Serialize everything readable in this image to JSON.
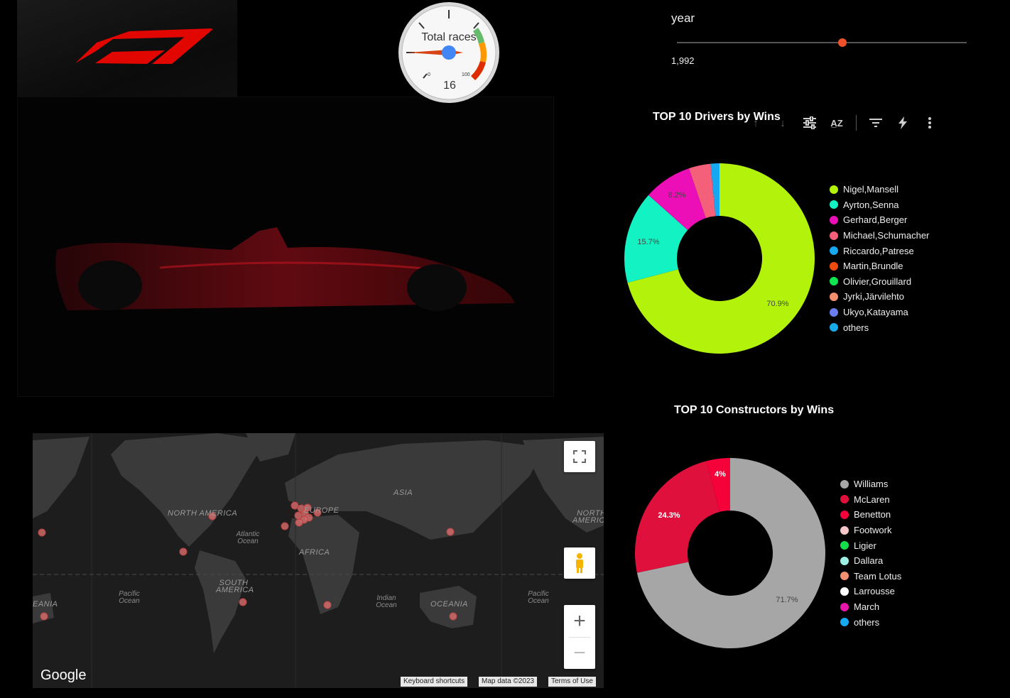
{
  "gauge": {
    "label": "Total races",
    "value": 16,
    "min_label": "0",
    "max_label": "100"
  },
  "slider": {
    "label": "year",
    "value": "1,992",
    "fraction": 0.57
  },
  "toolbar": {
    "icons": [
      "arrow-up-icon",
      "arrow-down-icon",
      "tune-icon",
      "sort-az-icon",
      "filter-icon",
      "bolt-icon",
      "more-vert-icon"
    ]
  },
  "drivers_chart": {
    "title": "TOP 10 Drivers by Wins",
    "legend": [
      "Nigel,Mansell",
      "Ayrton,Senna",
      "Gerhard,Berger",
      "Michael,Schumacher",
      "Riccardo,Patrese",
      "Martin,Brundle",
      "Olivier,Grouillard",
      "Jyrki,Järvilehto",
      "Ukyo,Katayama",
      "others"
    ],
    "colors": [
      "#b3f20b",
      "#13f2c3",
      "#ec0fb7",
      "#f4607a",
      "#16a8f0",
      "#ef4a10",
      "#0fe550",
      "#f49070",
      "#6d7cf0",
      "#17a9e9"
    ]
  },
  "constructors_chart": {
    "title": "TOP 10 Constructors by Wins",
    "legend": [
      "Williams",
      "McLaren",
      "Benetton",
      "Footwork",
      "Ligier",
      "Dallara",
      "Team Lotus",
      "Larrousse",
      "March",
      "others"
    ],
    "colors": [
      "#a6a6a6",
      "#e0103d",
      "#f5023b",
      "#f6c6cb",
      "#14de4a",
      "#9cf0e3",
      "#f39171",
      "#ffffff",
      "#e516a9",
      "#16a8f0"
    ]
  },
  "chart_data": [
    {
      "type": "pie",
      "title": "TOP 10 Drivers by Wins",
      "categories": [
        "Nigel,Mansell",
        "Ayrton,Senna",
        "Gerhard,Berger",
        "Michael,Schumacher",
        "Riccardo,Patrese"
      ],
      "values": [
        70.9,
        15.7,
        8.2,
        3.7,
        1.5
      ],
      "labels": [
        "70.9%",
        "15.7%",
        "8.2%",
        "",
        ""
      ]
    },
    {
      "type": "pie",
      "title": "TOP 10 Constructors by Wins",
      "categories": [
        "Williams",
        "McLaren",
        "Benetton"
      ],
      "values": [
        71.7,
        24.3,
        4
      ],
      "labels": [
        "71.7%",
        "24.3%",
        "4%"
      ]
    }
  ],
  "map": {
    "labels": {
      "north_america": "NORTH AMERICA",
      "north_america_right": "NORTH AMERICA",
      "south_america": "SOUTH AMERICA",
      "europe": "EUROPE",
      "asia": "ASIA",
      "africa": "AFRICA",
      "oceania": "OCEANIA",
      "oceania_left": "EANIA",
      "atlantic": "Atlantic Ocean",
      "indian": "Indian Ocean",
      "pacific_left": "Pacific Ocean",
      "pacific_right": "Pacific Ocean"
    },
    "google": "Google",
    "footer": [
      "Keyboard shortcuts",
      "Map data ©2023",
      "Terms of Use"
    ],
    "controls": [
      "fullscreen-icon",
      "pegman-icon",
      "zoom-in-icon",
      "zoom-out-icon"
    ]
  }
}
